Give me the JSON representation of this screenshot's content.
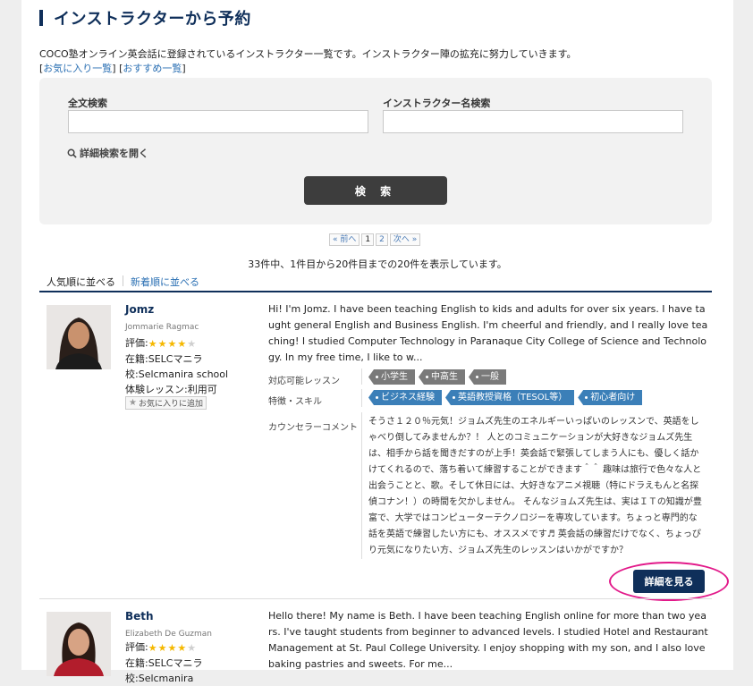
{
  "page": {
    "title": "インストラクターから予約",
    "intro": "COCO塾オンライン英会話に登録されているインストラクター一覧です。インストラクター陣の拡充に努力していきます。",
    "links": [
      "お気に入り一覧",
      "おすすめ一覧"
    ]
  },
  "search": {
    "fulltext_label": "全文検索",
    "name_label": "インストラクター名検索",
    "fulltext_value": "",
    "name_value": "",
    "advanced": "詳細検索を開く",
    "button": "検 索"
  },
  "pager": {
    "prev": "« 前へ",
    "pages": [
      "1",
      "2"
    ],
    "next": "次へ »",
    "summary": "33件中、1件目から20件目までの20件を表示しています。"
  },
  "sort": {
    "popular": "人気順に並べる",
    "newest": "新着順に並べる"
  },
  "labels": {
    "lessons": "対応可能レッスン",
    "skills": "特徴・スキル",
    "comment": "カウンセラーコメント",
    "detail_button": "詳細を見る",
    "fav_button": "お気に入りに追加"
  },
  "instructors": [
    {
      "name": "Jomz",
      "full_name": "Jommarie Ragmac",
      "rating_label": "評価:",
      "rating": 4,
      "school": "在籍:SELCマニラ校:Selcmanira school",
      "trial": "体験レッスン:利用可",
      "bio": "Hi! I'm Jomz. I have been teaching English to kids and adults for over six years. I have taught general English and Business English. I'm cheerful and friendly, and I really love teaching! I studied Computer Technology in Paranaque City College of Science and Technology. In my free time, I like to w...",
      "lessons": [
        "小学生",
        "中高生",
        "一般"
      ],
      "skills": [
        "ビジネス経験",
        "英語教授資格（TESOL等）",
        "初心者向け"
      ],
      "comment": "そうさ１２０％元気！ジョムズ先生のエネルギーいっぱいのレッスンで、英語をしゃべり倒してみませんか？！ 人とのコミュニケーションが大好きなジョムズ先生は、相手から話を聞きだすのが上手！英会話で緊張してしまう人にも、優しく話かけてくれるので、落ち着いて練習することができます＾＾ 趣味は旅行で色々な人と出会うことと、歌。そして休日には、大好きなアニメ視聴（特にドラえもんと名探偵コナン！）の時間を欠かしません。 そんなジョムズ先生は、実はＩＴの知識が豊富で、大学ではコンピューターテクノロジーを専攻しています。ちょっと専門的な話を英語で練習したい方にも、オススメです♬ 英会話の練習だけでなく、ちょっぴり元気になりたい方、ジョムズ先生のレッスンはいかがですか？"
    },
    {
      "name": "Beth",
      "full_name": "Elizabeth De Guzman",
      "rating_label": "評価:",
      "rating": 4,
      "school": "在籍:SELCマニラ校:Selcmanira",
      "bio": "Hello there! My name is Beth. I have been teaching English online for more than two years. I've taught students from beginner to advanced levels. I studied Hotel and Restaurant Management at St. Paul College University. I enjoy shopping with my son, and I also love baking pastries and sweets. For me..."
    }
  ],
  "colors": {
    "navy": "#0f2f5a",
    "link": "#2a6fb3",
    "star": "#f5b800",
    "highlight": "#e21a8a",
    "tag_gray": "#7a7a7a",
    "tag_blue": "#3b7fb8"
  }
}
